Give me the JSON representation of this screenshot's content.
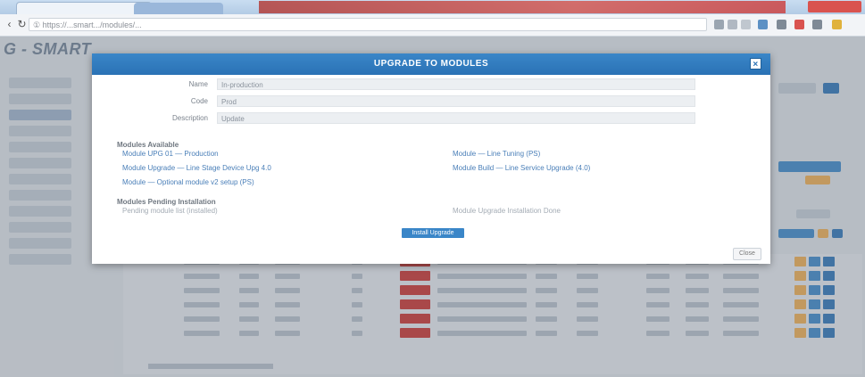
{
  "browser": {
    "url": "① https://...smart.../modules/...",
    "tab1_label": "",
    "tab2_label": ""
  },
  "app": {
    "logo": "G - SMART"
  },
  "modal": {
    "title": "UPGRADE TO MODULES",
    "close_glyph": "×",
    "fields": [
      {
        "label": "Name",
        "value": "In-production"
      },
      {
        "label": "Code",
        "value": "Prod"
      },
      {
        "label": "Description",
        "value": "Update"
      }
    ],
    "section1_title": "Modules Available",
    "section1_links_left": [
      "Module UPG 01 — Production",
      "Module Upgrade — Line Stage Device Upg 4.0",
      "Module — Optional module v2 setup (PS)"
    ],
    "section1_links_right": [
      "Module — Line Tuning (PS)",
      "Module Build — Line Service Upgrade (4.0)"
    ],
    "section2_title": "Modules Pending Installation",
    "section2_left": "Pending module list (installed)",
    "section2_right": "Module Upgrade Installation Done",
    "primary_button": "Install Upgrade",
    "close_button": "Close"
  },
  "colors": {
    "header": "#2a72b5",
    "accent": "#3a86c8",
    "danger": "#c9302c",
    "warning": "#f0ad4e"
  }
}
